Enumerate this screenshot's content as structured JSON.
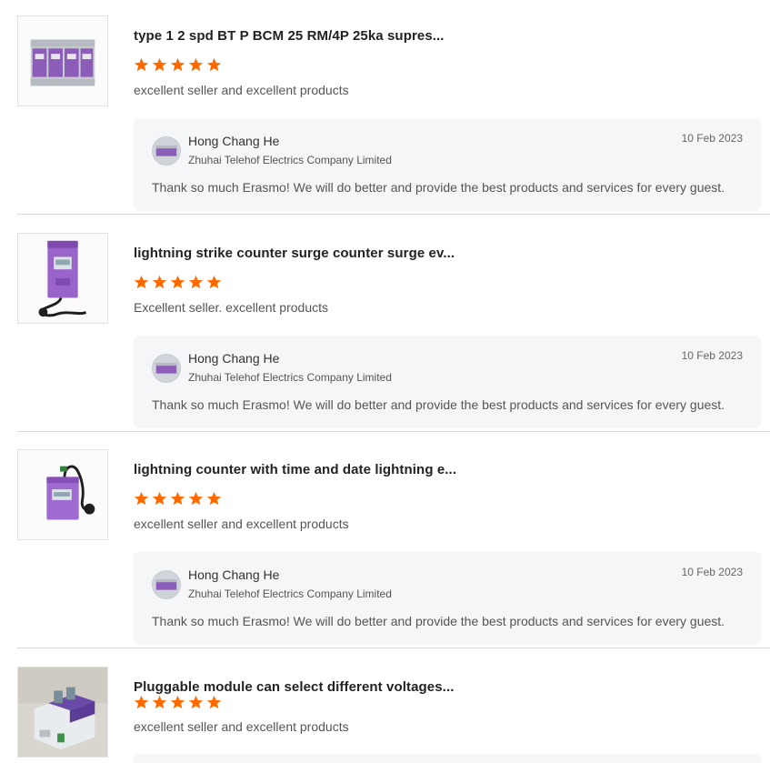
{
  "colors": {
    "star": "#ff6a00",
    "reply_bg": "#f5f6f8",
    "divider": "#d9d9d9"
  },
  "reviews": [
    {
      "product_title": "type 1 2 spd BT P BCM 25 RM/4P 25ka supres...",
      "rating": 5,
      "comment": "excellent seller and excellent products",
      "image_icon": "surge-protector-4p-icon",
      "reply": {
        "name": "Hong Chang He",
        "company": "Zhuhai Telehof Electrics Company Limited",
        "date": "10 Feb 2023",
        "text": "Thank so much Erasmo!  We will do better and provide the best products and services for every guest."
      }
    },
    {
      "product_title": "lightning strike counter surge counter surge ev...",
      "rating": 5,
      "comment": "Excellent seller. excellent products",
      "image_icon": "lightning-counter-icon",
      "reply": {
        "name": "Hong Chang He",
        "company": "Zhuhai Telehof Electrics Company Limited",
        "date": "10 Feb 2023",
        "text": "Thank so much Erasmo!  We will do better and provide the best products and services for every guest."
      }
    },
    {
      "product_title": "lightning counter with time and date lightning e...",
      "rating": 5,
      "comment": "excellent seller and excellent products",
      "image_icon": "lightning-counter-icon",
      "reply": {
        "name": "Hong Chang He",
        "company": "Zhuhai Telehof Electrics Company Limited",
        "date": "10 Feb 2023",
        "text": "Thank so much Erasmo!  We will do better and provide the best products and services for every guest."
      }
    },
    {
      "product_title": "Pluggable module can select different voltages...",
      "rating": 5,
      "comment": "excellent seller and excellent products",
      "image_icon": "pluggable-module-icon"
    }
  ]
}
